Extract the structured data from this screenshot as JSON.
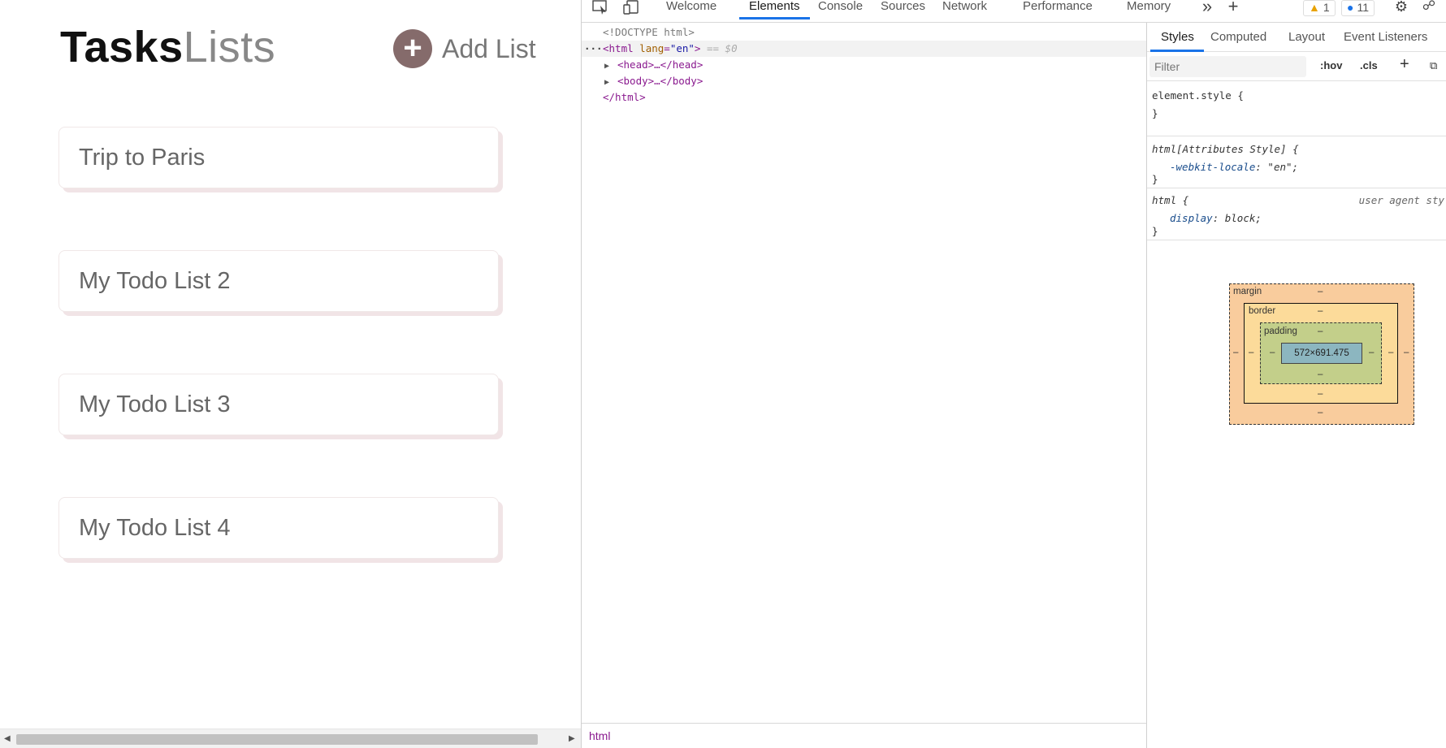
{
  "app": {
    "logo_bold": "Tasks",
    "logo_light": "Lists",
    "add_list_icon": "+",
    "add_list_label": "Add List",
    "lists": [
      {
        "title": "Trip to Paris"
      },
      {
        "title": "My Todo List 2"
      },
      {
        "title": "My Todo List 3"
      },
      {
        "title": "My Todo List 4"
      }
    ]
  },
  "devtools": {
    "tabs": [
      "Welcome",
      "Elements",
      "Console",
      "Sources",
      "Network",
      "Performance",
      "Memory"
    ],
    "active_tab": "Elements",
    "more_tabs_icon": "»",
    "new_tab_icon": "+",
    "warning_count": "1",
    "message_count": "11",
    "dom": {
      "doctype": "<!DOCTYPE html>",
      "html_open_tag": "<html",
      "html_attr_name": "lang",
      "html_attr_value": "\"en\"",
      "html_close_bracket": ">",
      "selected_marker": "== $0",
      "head_line": "<head>…</head>",
      "body_line": "<body>…</body>",
      "html_close": "</html>"
    },
    "breadcrumb": "html",
    "styles": {
      "subtabs": [
        "Styles",
        "Computed",
        "Layout",
        "Event Listeners"
      ],
      "filter_placeholder": "Filter",
      "hov_label": ":hov",
      "cls_label": ".cls",
      "add_rule_icon": "+",
      "rule1_selector": "element.style {",
      "rule2_selector": "html[Attributes Style] {",
      "rule2_prop": "-webkit-locale",
      "rule2_value": "\"en\";",
      "rule3_selector": "html {",
      "rule3_origin": "user agent sty",
      "rule3_prop": "display",
      "rule3_value": "block;",
      "close_brace": "}"
    },
    "box_model": {
      "margin_label": "margin",
      "border_label": "border",
      "padding_label": "padding",
      "content_size": "572×691.475",
      "dash": "–"
    }
  }
}
